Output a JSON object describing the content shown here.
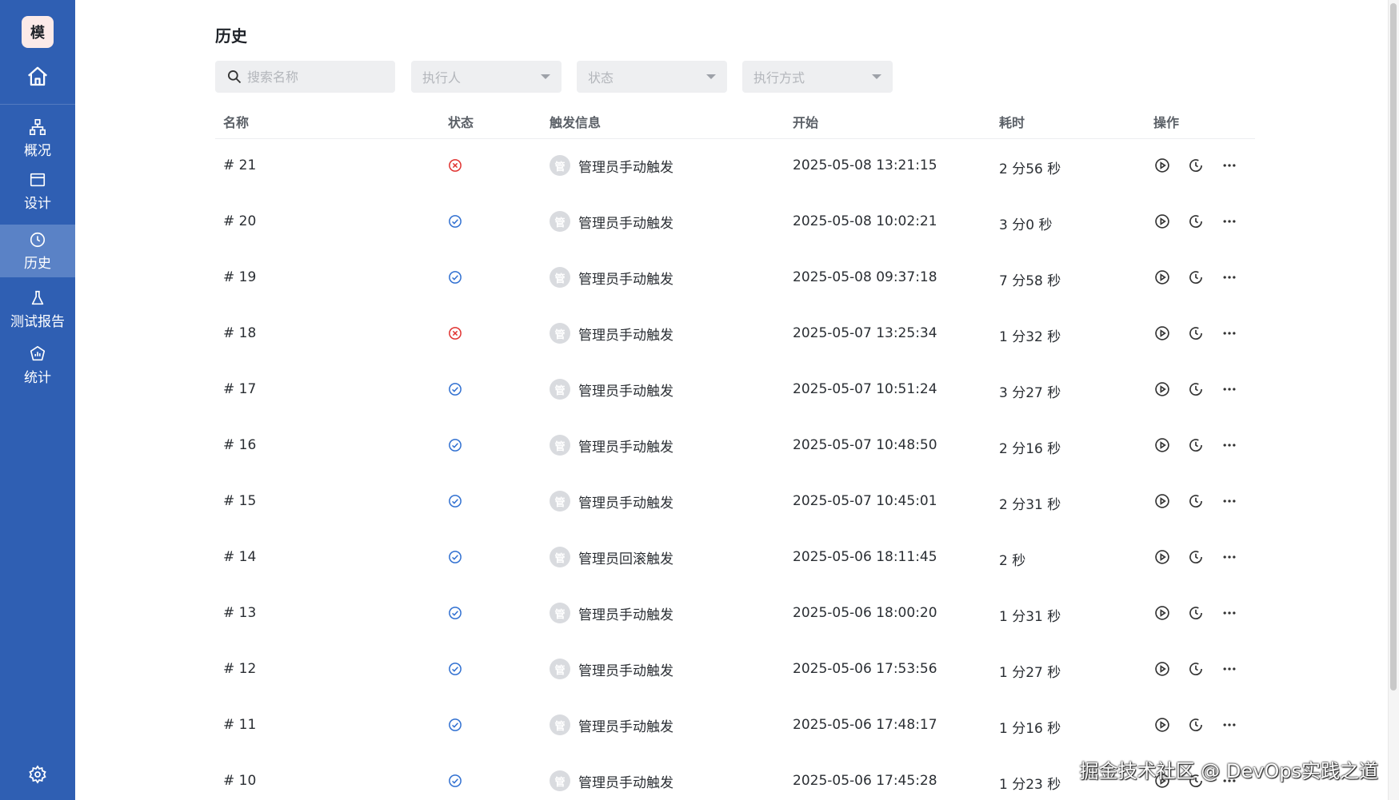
{
  "sidebar": {
    "logo": "模",
    "items": [
      {
        "label": "概况",
        "icon": "sitemap-icon",
        "active": false
      },
      {
        "label": "设计",
        "icon": "card-icon",
        "active": false
      },
      {
        "label": "历史",
        "icon": "clock-icon",
        "active": true
      },
      {
        "label": "测试报告",
        "icon": "flask-icon",
        "active": false
      },
      {
        "label": "统计",
        "icon": "chart-badge-icon",
        "active": false
      }
    ]
  },
  "page": {
    "title": "历史"
  },
  "filters": {
    "search_placeholder": "搜索名称",
    "executor_placeholder": "执行人",
    "status_placeholder": "状态",
    "mode_placeholder": "执行方式"
  },
  "table": {
    "headers": {
      "name": "名称",
      "status": "状态",
      "trigger": "触发信息",
      "start": "开始",
      "duration": "耗时",
      "ops": "操作"
    },
    "avatar_text": "管",
    "rows": [
      {
        "name": "# 21",
        "status": "failed",
        "trigger": "管理员手动触发",
        "start": "2025-05-08 13:21:15",
        "duration": "2 分56 秒"
      },
      {
        "name": "# 20",
        "status": "success",
        "trigger": "管理员手动触发",
        "start": "2025-05-08 10:02:21",
        "duration": "3 分0 秒"
      },
      {
        "name": "# 19",
        "status": "success",
        "trigger": "管理员手动触发",
        "start": "2025-05-08 09:37:18",
        "duration": "7 分58 秒"
      },
      {
        "name": "# 18",
        "status": "failed",
        "trigger": "管理员手动触发",
        "start": "2025-05-07 13:25:34",
        "duration": "1 分32 秒"
      },
      {
        "name": "# 17",
        "status": "success",
        "trigger": "管理员手动触发",
        "start": "2025-05-07 10:51:24",
        "duration": "3 分27 秒"
      },
      {
        "name": "# 16",
        "status": "success",
        "trigger": "管理员手动触发",
        "start": "2025-05-07 10:48:50",
        "duration": "2 分16 秒"
      },
      {
        "name": "# 15",
        "status": "success",
        "trigger": "管理员手动触发",
        "start": "2025-05-07 10:45:01",
        "duration": "2 分31 秒"
      },
      {
        "name": "# 14",
        "status": "success",
        "trigger": "管理员回滚触发",
        "start": "2025-05-06 18:11:45",
        "duration": "2 秒"
      },
      {
        "name": "# 13",
        "status": "success",
        "trigger": "管理员手动触发",
        "start": "2025-05-06 18:00:20",
        "duration": "1 分31 秒"
      },
      {
        "name": "# 12",
        "status": "success",
        "trigger": "管理员手动触发",
        "start": "2025-05-06 17:53:56",
        "duration": "1 分27 秒"
      },
      {
        "name": "# 11",
        "status": "success",
        "trigger": "管理员手动触发",
        "start": "2025-05-06 17:48:17",
        "duration": "1 分16 秒"
      },
      {
        "name": "# 10",
        "status": "success",
        "trigger": "管理员手动触发",
        "start": "2025-05-06 17:45:28",
        "duration": "1 分23 秒"
      }
    ]
  },
  "colors": {
    "sidebar": "#2f5fb3",
    "success": "#2f6fd1",
    "failed": "#e0312f"
  },
  "watermark": "掘金技术社区 @ DevOps实践之道"
}
